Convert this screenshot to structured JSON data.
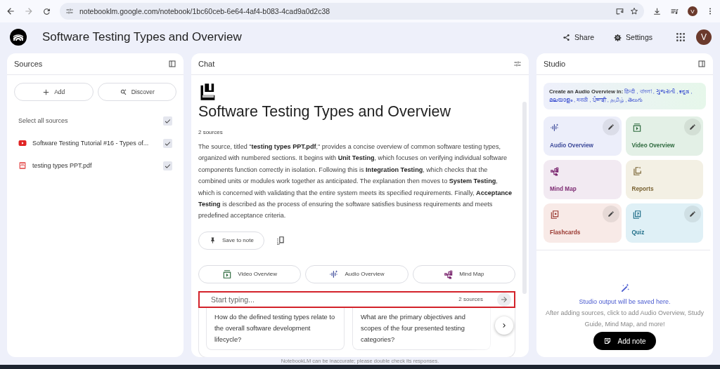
{
  "browser": {
    "url": "notebooklm.google.com/notebook/1bc60ceb-6e64-4af4-b083-4cad9a0d2c38",
    "profile": "V"
  },
  "header": {
    "title": "Software Testing Types and Overview",
    "buttons": [
      {
        "kind": "share",
        "label": "Share"
      },
      {
        "kind": "settings",
        "label": "Settings"
      }
    ],
    "avatar": "V"
  },
  "sources": {
    "title": "Sources",
    "actions": [
      {
        "kind": "add",
        "label": "Add"
      },
      {
        "kind": "discover",
        "label": "Discover"
      }
    ],
    "select_all": {
      "label": "Select all sources",
      "checked": true
    },
    "items": [
      {
        "kind": "video",
        "name": "Software Testing Tutorial #16 - Types of...",
        "checked": true
      },
      {
        "kind": "pdf",
        "name": "testing types PPT.pdf",
        "checked": true
      }
    ]
  },
  "chat": {
    "title": "Chat",
    "heading": "Software Testing Types and Overview",
    "source_count": "2 sources",
    "summary": "The source, titled \"**testing types PPT.pdf**,\" provides a concise overview of common software testing types, organized with numbered sections. It begins with **Unit Testing**, which focuses on verifying individual software components function correctly in isolation. Following this is **Integration Testing**, which checks that the combined units or modules work together as anticipated. The explanation then moves to **System Testing**, which is concerned with validating that the entire system meets its specified requirements. Finally, **Acceptance Testing** is described as the process of ensuring the software satisfies business requirements and meets predefined acceptance criteria.",
    "save_button": "Save to note",
    "actions": [
      {
        "kind": "video",
        "label": "Video Overview"
      },
      {
        "kind": "audio",
        "label": "Audio Overview"
      },
      {
        "kind": "mindmap",
        "label": "Mind Map"
      }
    ],
    "input": {
      "placeholder": "Start typing...",
      "source_count": "2 sources"
    },
    "suggestions": [
      "How do the defined testing types relate to the overall software development lifecycle?",
      "What are the primary objectives and scopes of the four presented testing categories?"
    ],
    "disclaimer": "NotebookLM can be inaccurate; please double check its responses."
  },
  "studio": {
    "title": "Studio",
    "banner": {
      "label": "Create an Audio Overview in:",
      "languages": [
        "हिन्दी",
        "বাংলা",
        "ગુજરાતી",
        "ಕನ್ನಡ",
        "മലയാളം",
        "मराठी",
        "ਪੰਜਾਬੀ",
        "தமிழ்",
        "తెలుగు"
      ],
      "separator": ","
    },
    "tiles": [
      {
        "kind": "audio",
        "label": "Audio Overview",
        "color": "#eceefa",
        "editable": true
      },
      {
        "kind": "video",
        "label": "Video Overview",
        "color": "#e3f0e6",
        "editable": true
      },
      {
        "kind": "mindmap",
        "label": "Mind Map",
        "color": "#f2eaf2",
        "editable": false
      },
      {
        "kind": "reports",
        "label": "Reports",
        "color": "#f3f0e4",
        "editable": false
      },
      {
        "kind": "flashcards",
        "label": "Flashcards",
        "color": "#f8eae7",
        "editable": true
      },
      {
        "kind": "quiz",
        "label": "Quiz",
        "color": "#dff0f6",
        "editable": true
      }
    ],
    "empty_title": "Studio output will be saved here.",
    "empty_text": "After adding sources, click to add Audio Overview, Study Guide, Mind Map, and more!",
    "add_note": "Add note"
  }
}
